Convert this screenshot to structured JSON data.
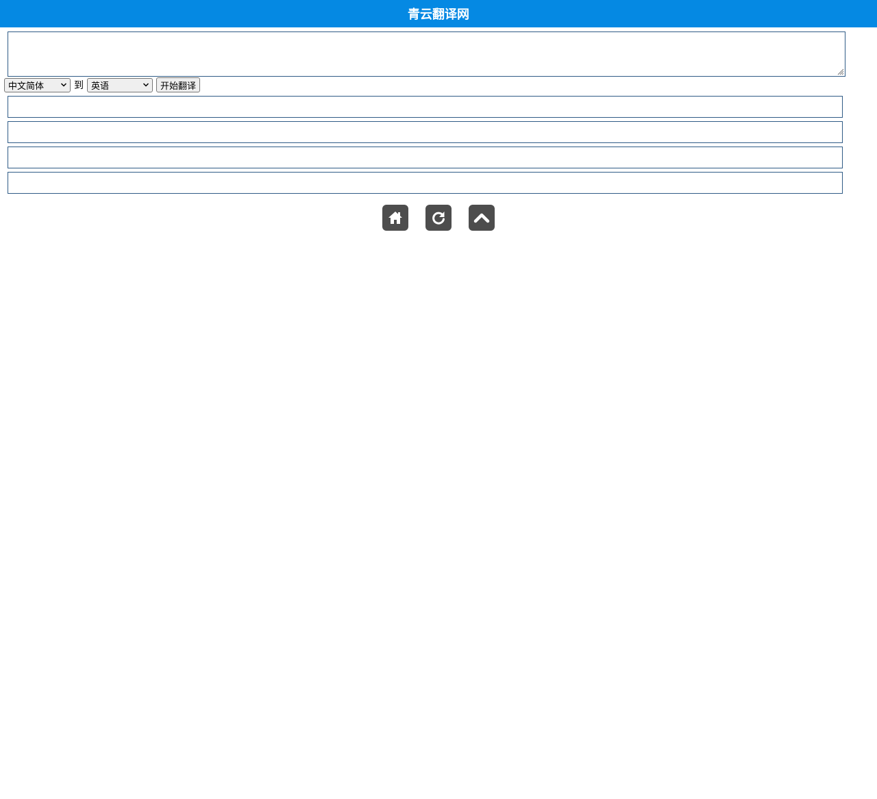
{
  "header": {
    "title": "青云翻译网",
    "bg": "#0589e3"
  },
  "source": {
    "value": "",
    "placeholder": ""
  },
  "controls": {
    "source_lang": "中文简体",
    "to_label": "到",
    "target_lang": "英语",
    "translate_label": "开始翻译"
  },
  "results": [
    "",
    "",
    "",
    ""
  ],
  "footer_icons": [
    "home-icon",
    "refresh-icon",
    "chevron-up-icon"
  ]
}
